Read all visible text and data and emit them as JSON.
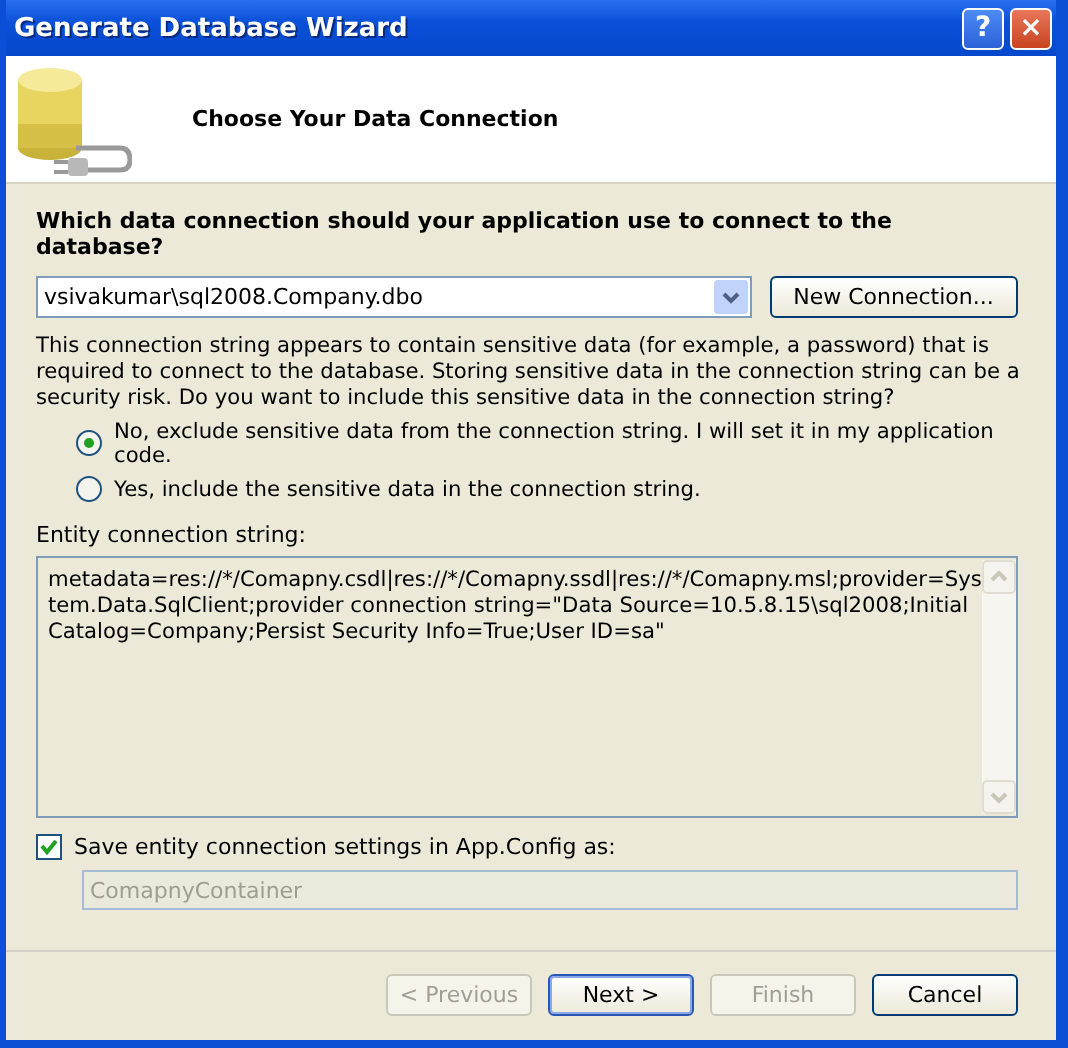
{
  "window": {
    "title": "Generate Database Wizard",
    "help_button": "?",
    "close_button": "×"
  },
  "header": {
    "title": "Choose Your Data Connection"
  },
  "question": "Which data connection should your application use to connect to the database?",
  "connection": {
    "value": "vsivakumar\\sql2008.Company.dbo",
    "new_button": "New Connection..."
  },
  "warning": "This connection string appears to contain sensitive data (for example, a password) that is required to connect to the database. Storing sensitive data in the connection string can be a security risk. Do you want to include this sensitive data in the connection string?",
  "options": [
    {
      "label": "No, exclude sensitive data from the connection string. I will set it in my application code.",
      "selected": true
    },
    {
      "label": "Yes, include the sensitive data in the connection string.",
      "selected": false
    }
  ],
  "entity_label": "Entity connection string:",
  "entity_string": "metadata=res://*/Comapny.csdl|res://*/Comapny.ssdl|res://*/Comapny.msl;provider=System.Data.SqlClient;provider connection string=\"Data Source=10.5.8.15\\sql2008;Initial Catalog=Company;Persist Security Info=True;User ID=sa\"",
  "save_setting": {
    "label": "Save entity connection settings in App.Config as:",
    "checked": true,
    "name": "ComapnyContainer",
    "disabled": true
  },
  "buttons": [
    {
      "label": "< Previous",
      "disabled": true,
      "default": false
    },
    {
      "label": "Next >",
      "disabled": false,
      "default": true
    },
    {
      "label": "Finish",
      "disabled": true,
      "default": false
    },
    {
      "label": "Cancel",
      "disabled": false,
      "default": false
    }
  ]
}
